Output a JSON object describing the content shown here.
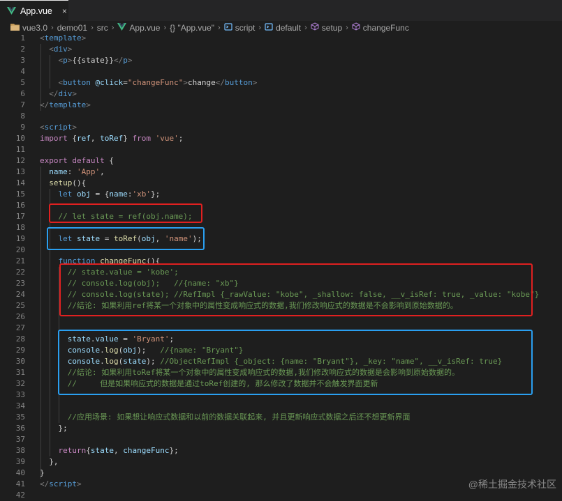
{
  "tab": {
    "name": "App.vue",
    "close": "×",
    "icon": "vue-logo-icon"
  },
  "breadcrumb": [
    {
      "label": "vue3.0",
      "icon": "folder-icon"
    },
    {
      "label": "demo01",
      "icon": ""
    },
    {
      "label": "src",
      "icon": ""
    },
    {
      "label": "App.vue",
      "icon": "vue-logo-icon"
    },
    {
      "label": "{} \"App.vue\"",
      "icon": ""
    },
    {
      "label": "script",
      "icon": "symbol-icon"
    },
    {
      "label": "default",
      "icon": "symbol-icon"
    },
    {
      "label": "setup",
      "icon": "cube-icon"
    },
    {
      "label": "changeFunc",
      "icon": "cube-icon"
    }
  ],
  "colors": {
    "tag": "#569cd6",
    "keyword": "#569cd6",
    "function": "#dcdcaa",
    "string": "#ce9178",
    "variable": "#9cdcfe",
    "comment": "#6a9955",
    "text": "#d4d4d4",
    "punct": "#808080",
    "red_box": "#e02020",
    "blue_box": "#2a9ff0"
  },
  "lines": [
    {
      "n": "1",
      "t": [
        [
          "pn",
          "<"
        ],
        [
          "tag",
          "template"
        ],
        [
          "pn",
          ">"
        ]
      ]
    },
    {
      "n": "2",
      "t": [
        [
          "txt",
          "  "
        ],
        [
          "pn",
          "<"
        ],
        [
          "tag",
          "div"
        ],
        [
          "pn",
          ">"
        ]
      ]
    },
    {
      "n": "3",
      "t": [
        [
          "txt",
          "    "
        ],
        [
          "pn",
          "<"
        ],
        [
          "tag",
          "p"
        ],
        [
          "pn",
          ">"
        ],
        [
          "txt",
          "{{state}}"
        ],
        [
          "pn",
          "</"
        ],
        [
          "tag",
          "p"
        ],
        [
          "pn",
          ">"
        ]
      ]
    },
    {
      "n": "4",
      "t": []
    },
    {
      "n": "5",
      "t": [
        [
          "txt",
          "    "
        ],
        [
          "pn",
          "<"
        ],
        [
          "tag",
          "button"
        ],
        [
          "txt",
          " "
        ],
        [
          "attr",
          "@click"
        ],
        [
          "txt",
          "="
        ],
        [
          "str",
          "\"changeFunc\""
        ],
        [
          "pn",
          ">"
        ],
        [
          "txt",
          "change"
        ],
        [
          "pn",
          "</"
        ],
        [
          "tag",
          "button"
        ],
        [
          "pn",
          ">"
        ]
      ]
    },
    {
      "n": "6",
      "t": [
        [
          "txt",
          "  "
        ],
        [
          "pn",
          "</"
        ],
        [
          "tag",
          "div"
        ],
        [
          "pn",
          ">"
        ]
      ]
    },
    {
      "n": "7",
      "t": [
        [
          "pn",
          "</"
        ],
        [
          "tag",
          "template"
        ],
        [
          "pn",
          ">"
        ]
      ]
    },
    {
      "n": "8",
      "t": []
    },
    {
      "n": "9",
      "t": [
        [
          "pn",
          "<"
        ],
        [
          "tag",
          "script"
        ],
        [
          "pn",
          ">"
        ]
      ]
    },
    {
      "n": "10",
      "t": [
        [
          "c",
          "import"
        ],
        [
          "txt",
          " {"
        ],
        [
          "var",
          "ref"
        ],
        [
          "txt",
          ", "
        ],
        [
          "var",
          "toRef"
        ],
        [
          "txt",
          "} "
        ],
        [
          "c",
          "from"
        ],
        [
          "txt",
          " "
        ],
        [
          "str",
          "'vue'"
        ],
        [
          "txt",
          ";"
        ]
      ]
    },
    {
      "n": "11",
      "t": []
    },
    {
      "n": "12",
      "t": [
        [
          "c",
          "export"
        ],
        [
          "txt",
          " "
        ],
        [
          "c",
          "default"
        ],
        [
          "txt",
          " {"
        ]
      ]
    },
    {
      "n": "13",
      "t": [
        [
          "txt",
          "  "
        ],
        [
          "var",
          "name"
        ],
        [
          "txt",
          ": "
        ],
        [
          "str",
          "'App'"
        ],
        [
          "txt",
          ","
        ]
      ]
    },
    {
      "n": "14",
      "t": [
        [
          "txt",
          "  "
        ],
        [
          "fn",
          "setup"
        ],
        [
          "txt",
          "(){"
        ]
      ]
    },
    {
      "n": "15",
      "t": [
        [
          "txt",
          "    "
        ],
        [
          "kw",
          "let"
        ],
        [
          "txt",
          " "
        ],
        [
          "var",
          "obj"
        ],
        [
          "txt",
          " = {"
        ],
        [
          "var",
          "name"
        ],
        [
          "txt",
          ":"
        ],
        [
          "str",
          "'xb'"
        ],
        [
          "txt",
          "};"
        ]
      ]
    },
    {
      "n": "16",
      "t": []
    },
    {
      "n": "17",
      "t": [
        [
          "txt",
          "    "
        ],
        [
          "cm",
          "// let state = ref(obj.name);"
        ]
      ]
    },
    {
      "n": "18",
      "t": []
    },
    {
      "n": "19",
      "t": [
        [
          "txt",
          "    "
        ],
        [
          "kw",
          "let"
        ],
        [
          "txt",
          " "
        ],
        [
          "var",
          "state"
        ],
        [
          "txt",
          " = "
        ],
        [
          "fn",
          "toRef"
        ],
        [
          "txt",
          "("
        ],
        [
          "var",
          "obj"
        ],
        [
          "txt",
          ", "
        ],
        [
          "str",
          "'name'"
        ],
        [
          "txt",
          ");"
        ]
      ]
    },
    {
      "n": "20",
      "t": []
    },
    {
      "n": "21",
      "t": [
        [
          "txt",
          "    "
        ],
        [
          "kw",
          "function"
        ],
        [
          "txt",
          " "
        ],
        [
          "fn",
          "changeFunc"
        ],
        [
          "txt",
          "(){"
        ]
      ]
    },
    {
      "n": "22",
      "t": [
        [
          "txt",
          "      "
        ],
        [
          "cm",
          "// state.value = 'kobe';"
        ]
      ]
    },
    {
      "n": "23",
      "t": [
        [
          "txt",
          "      "
        ],
        [
          "cm",
          "// console.log(obj);   //{name: \"xb\"}"
        ]
      ]
    },
    {
      "n": "24",
      "t": [
        [
          "txt",
          "      "
        ],
        [
          "cm",
          "// console.log(state); //RefImpl {_rawValue: \"kobe\", _shallow: false, __v_isRef: true, _value: \"kobe\"}"
        ]
      ]
    },
    {
      "n": "25",
      "t": [
        [
          "txt",
          "      "
        ],
        [
          "cm",
          "//结论: 如果利用ref将某一个对象中的属性变成响应式的数据,我们修改响应式的数据是不会影响到原始数据的。"
        ]
      ]
    },
    {
      "n": "26",
      "t": []
    },
    {
      "n": "27",
      "t": []
    },
    {
      "n": "28",
      "t": [
        [
          "txt",
          "      "
        ],
        [
          "var",
          "state"
        ],
        [
          "txt",
          "."
        ],
        [
          "var",
          "value"
        ],
        [
          "txt",
          " = "
        ],
        [
          "str",
          "'Bryant'"
        ],
        [
          "txt",
          ";"
        ]
      ]
    },
    {
      "n": "29",
      "t": [
        [
          "txt",
          "      "
        ],
        [
          "var",
          "console"
        ],
        [
          "txt",
          "."
        ],
        [
          "fn",
          "log"
        ],
        [
          "txt",
          "("
        ],
        [
          "var",
          "obj"
        ],
        [
          "txt",
          ");   "
        ],
        [
          "cm",
          "//{name: \"Bryant\"}"
        ]
      ]
    },
    {
      "n": "30",
      "t": [
        [
          "txt",
          "      "
        ],
        [
          "var",
          "console"
        ],
        [
          "txt",
          "."
        ],
        [
          "fn",
          "log"
        ],
        [
          "txt",
          "("
        ],
        [
          "var",
          "state"
        ],
        [
          "txt",
          "); "
        ],
        [
          "cm",
          "//ObjectRefImpl {_object: {name: \"Bryant\"}, _key: \"name\", __v_isRef: true}"
        ]
      ]
    },
    {
      "n": "31",
      "t": [
        [
          "txt",
          "      "
        ],
        [
          "cm",
          "//结论: 如果利用toRef将某一个对象中的属性变成响应式的数据,我们修改响应式的数据是会影响到原始数据的。"
        ]
      ]
    },
    {
      "n": "32",
      "t": [
        [
          "txt",
          "      "
        ],
        [
          "cm",
          "//     但是如果响应式的数据是通过toRef创建的, 那么修改了数据并不会触发界面更新"
        ]
      ]
    },
    {
      "n": "33",
      "t": []
    },
    {
      "n": "34",
      "t": []
    },
    {
      "n": "35",
      "t": [
        [
          "txt",
          "      "
        ],
        [
          "cm",
          "//应用场景: 如果想让响应式数据和以前的数据关联起来, 并且更新响应式数据之后还不想更新界面"
        ]
      ]
    },
    {
      "n": "36",
      "t": [
        [
          "txt",
          "    };"
        ]
      ]
    },
    {
      "n": "37",
      "t": []
    },
    {
      "n": "38",
      "t": [
        [
          "txt",
          "    "
        ],
        [
          "c",
          "return"
        ],
        [
          "txt",
          "{"
        ],
        [
          "var",
          "state"
        ],
        [
          "txt",
          ", "
        ],
        [
          "var",
          "changeFunc"
        ],
        [
          "txt",
          "};"
        ]
      ]
    },
    {
      "n": "39",
      "t": [
        [
          "txt",
          "  },"
        ]
      ]
    },
    {
      "n": "40",
      "t": [
        [
          "txt",
          "}"
        ]
      ]
    },
    {
      "n": "41",
      "t": [
        [
          "pn",
          "</"
        ],
        [
          "tag",
          "script"
        ],
        [
          "pn",
          ">"
        ]
      ]
    },
    {
      "n": "42",
      "t": []
    }
  ],
  "watermark": "@稀土掘金技术社区"
}
